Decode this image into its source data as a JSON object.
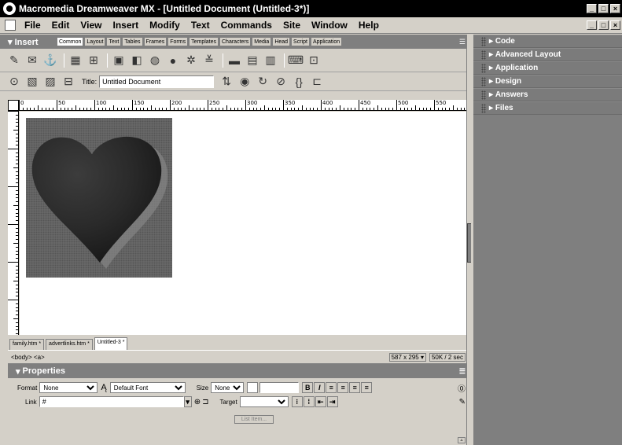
{
  "window": {
    "title": "Macromedia Dreamweaver MX - [Untitled Document (Untitled-3*)]"
  },
  "menu": [
    "File",
    "Edit",
    "View",
    "Insert",
    "Modify",
    "Text",
    "Commands",
    "Site",
    "Window",
    "Help"
  ],
  "insert_panel": {
    "title": "Insert",
    "tabs": [
      "Common",
      "Layout",
      "Text",
      "Tables",
      "Frames",
      "Forms",
      "Templates",
      "Characters",
      "Media",
      "Head",
      "Script",
      "Application"
    ],
    "active_tab": "Common"
  },
  "doc_toolbar": {
    "title_label": "Title:",
    "title_value": "Untitled Document"
  },
  "ruler": {
    "h_labels": [
      "0",
      "50",
      "100",
      "150",
      "200",
      "250",
      "300",
      "350",
      "400",
      "450",
      "500",
      "550"
    ]
  },
  "doc_tabs": [
    "family.htm *",
    "advertlinks.htm *",
    "Untitled-3 *"
  ],
  "status": {
    "tag": "<body> <a>",
    "size": "587 x 295",
    "download": "50K / 2 sec"
  },
  "properties": {
    "title": "Properties",
    "format_label": "Format",
    "format_value": "None",
    "font_value": "Default Font",
    "size_label": "Size",
    "size_value": "None",
    "link_label": "Link",
    "link_value": "#",
    "target_label": "Target",
    "list_item_label": "List Item...",
    "bold": "B",
    "italic": "I"
  },
  "right_panels": [
    "Code",
    "Advanced Layout",
    "Application",
    "Design",
    "Answers",
    "Files"
  ]
}
